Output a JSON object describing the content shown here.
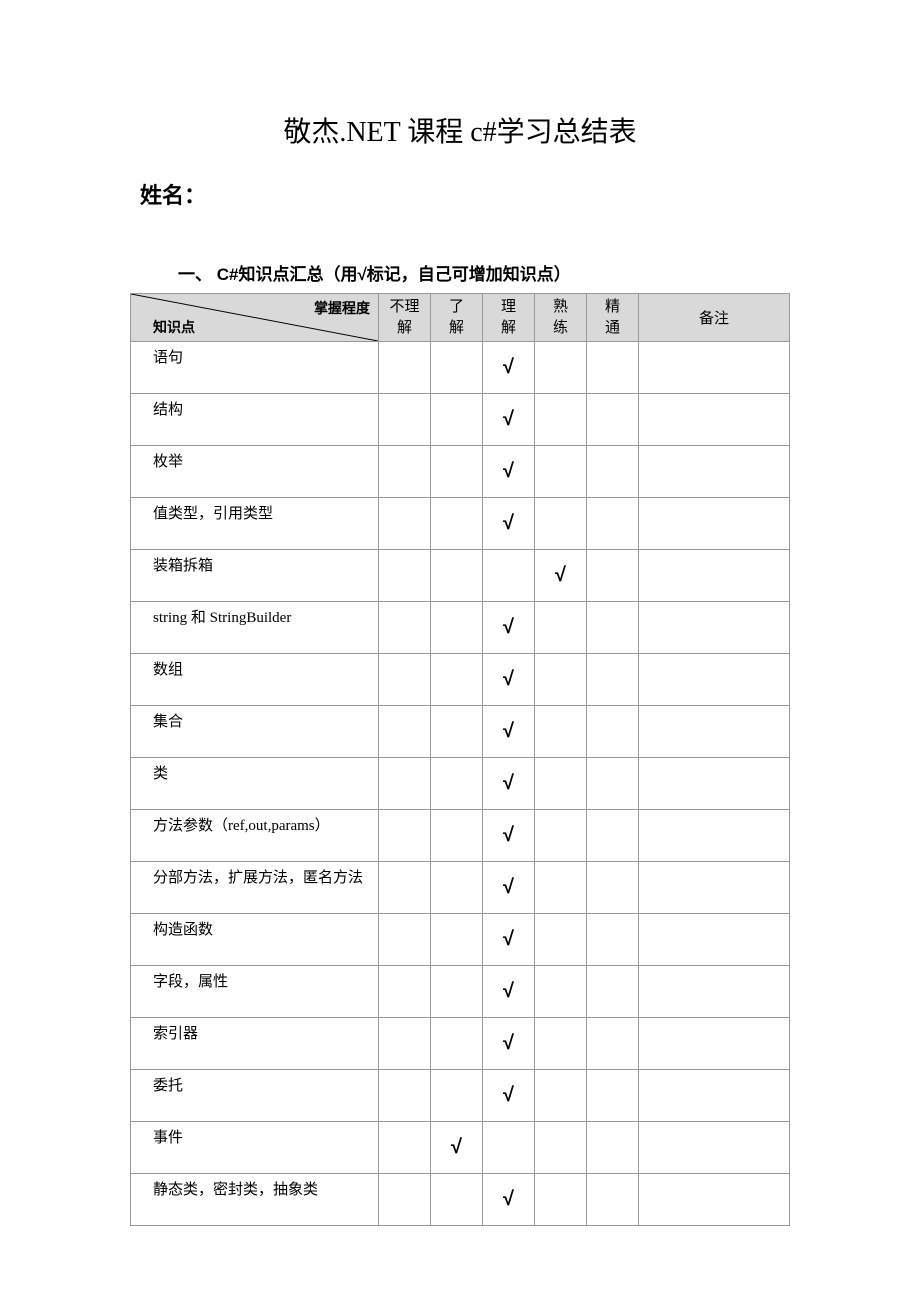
{
  "title": "敬杰.NET 课程 c#学习总结表",
  "name_label": "姓名：",
  "section": {
    "number": "一、",
    "heading": "C#知识点汇总（用√标记，自己可增加知识点）"
  },
  "header": {
    "diag_top": "掌握程度",
    "diag_bottom": "知识点",
    "levels": [
      {
        "l1": "不理",
        "l2": "解"
      },
      {
        "l1": "了",
        "l2": "解"
      },
      {
        "l1": "理",
        "l2": "解"
      },
      {
        "l1": "熟",
        "l2": "练"
      },
      {
        "l1": "精",
        "l2": "通"
      }
    ],
    "remark": "备注"
  },
  "checkmark": "√",
  "rows": [
    {
      "topic": "语句",
      "marks": [
        "",
        "",
        "√",
        "",
        ""
      ],
      "remark": ""
    },
    {
      "topic": "结构",
      "marks": [
        "",
        "",
        "√",
        "",
        ""
      ],
      "remark": ""
    },
    {
      "topic": "枚举",
      "marks": [
        "",
        "",
        "√",
        "",
        ""
      ],
      "remark": ""
    },
    {
      "topic": "值类型，引用类型",
      "marks": [
        "",
        "",
        "√",
        "",
        ""
      ],
      "remark": ""
    },
    {
      "topic": "装箱拆箱",
      "marks": [
        "",
        "",
        "",
        "√",
        ""
      ],
      "remark": ""
    },
    {
      "topic": "string 和 StringBuilder",
      "marks": [
        "",
        "",
        "√",
        "",
        ""
      ],
      "remark": ""
    },
    {
      "topic": "数组",
      "marks": [
        "",
        "",
        "√",
        "",
        ""
      ],
      "remark": ""
    },
    {
      "topic": "集合",
      "marks": [
        "",
        "",
        "√",
        "",
        ""
      ],
      "remark": ""
    },
    {
      "topic": "类",
      "marks": [
        "",
        "",
        "√",
        "",
        ""
      ],
      "remark": ""
    },
    {
      "topic": "方法参数（ref,out,params）",
      "marks": [
        "",
        "",
        "√",
        "",
        ""
      ],
      "remark": ""
    },
    {
      "topic": "分部方法，扩展方法，匿名方法",
      "marks": [
        "",
        "",
        "√",
        "",
        ""
      ],
      "remark": "",
      "wrap": true
    },
    {
      "topic": "构造函数",
      "marks": [
        "",
        "",
        "√",
        "",
        ""
      ],
      "remark": ""
    },
    {
      "topic": "字段，属性",
      "marks": [
        "",
        "",
        "√",
        "",
        ""
      ],
      "remark": ""
    },
    {
      "topic": "索引器",
      "marks": [
        "",
        "",
        "√",
        "",
        ""
      ],
      "remark": ""
    },
    {
      "topic": "委托",
      "marks": [
        "",
        "",
        "√",
        "",
        ""
      ],
      "remark": ""
    },
    {
      "topic": "事件",
      "marks": [
        "",
        "√",
        "",
        "",
        ""
      ],
      "remark": ""
    },
    {
      "topic": "静态类，密封类，抽象类",
      "marks": [
        "",
        "",
        "√",
        "",
        ""
      ],
      "remark": ""
    }
  ]
}
